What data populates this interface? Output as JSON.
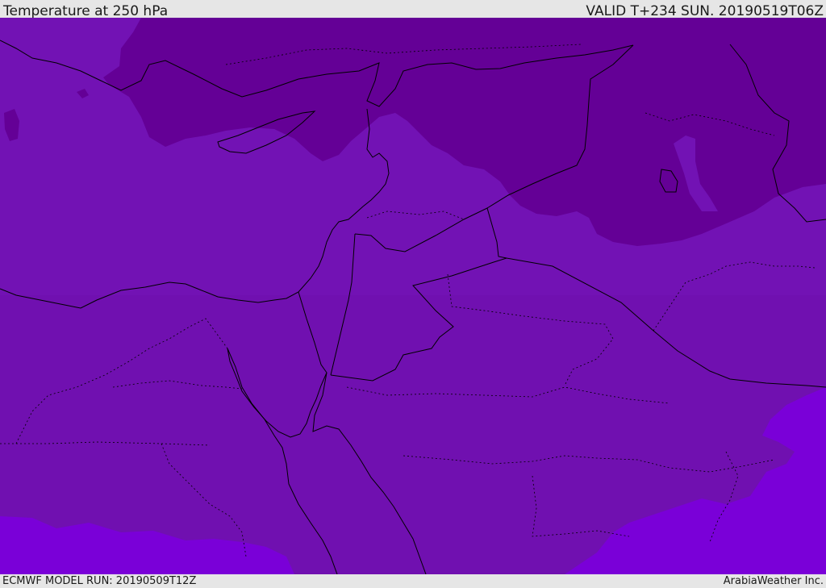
{
  "header": {
    "title": "Temperature at 250 hPa",
    "valid": "VALID T+234 SUN. 20190519T06Z"
  },
  "footer": {
    "model_run": "ECMWF MODEL RUN: 20190509T12Z",
    "provider": "ArabiaWeather Inc."
  },
  "colors": {
    "cold_band": "#640096",
    "mid_band": "#7212b4",
    "base_band": "#7010b0",
    "warm_band": "#7a00d8",
    "border_line": "#000000",
    "header_bg": "#e6e6e6"
  },
  "map": {
    "variable": "temperature",
    "level_hpa": 250,
    "region": "Eastern Mediterranean and Middle East"
  }
}
